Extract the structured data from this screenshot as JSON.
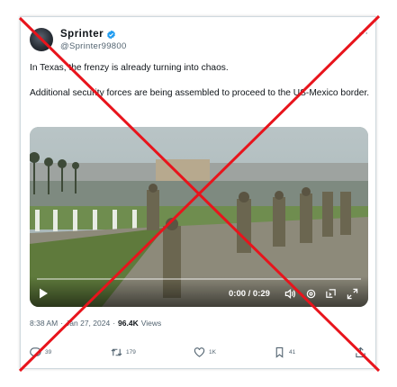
{
  "tweet": {
    "author_name": "Sprinter",
    "handle": "@Sprinter99800",
    "text_line1": "In Texas, the frenzy is already turning into chaos.",
    "text_line2": " Additional security forces are being assembled to proceed to the US-Mexico border.",
    "more_icon": "ellipsis-icon",
    "verified_color": "#1d9bf0"
  },
  "video": {
    "time_display": "0:00 / 0:29",
    "progress_fraction": 0,
    "icons": [
      "play-icon",
      "volume-icon",
      "settings-icon",
      "captions-icon",
      "fullscreen-icon"
    ]
  },
  "meta": {
    "time": "8:38 AM",
    "separator": "·",
    "date": "Jan 27, 2024",
    "views_count": "96.4K",
    "views_label": "Views"
  },
  "actions": {
    "replies": "39",
    "reposts": "179",
    "likes": "1K",
    "bookmarks": "41"
  },
  "overlay": {
    "cross_color": "#e8141c"
  }
}
